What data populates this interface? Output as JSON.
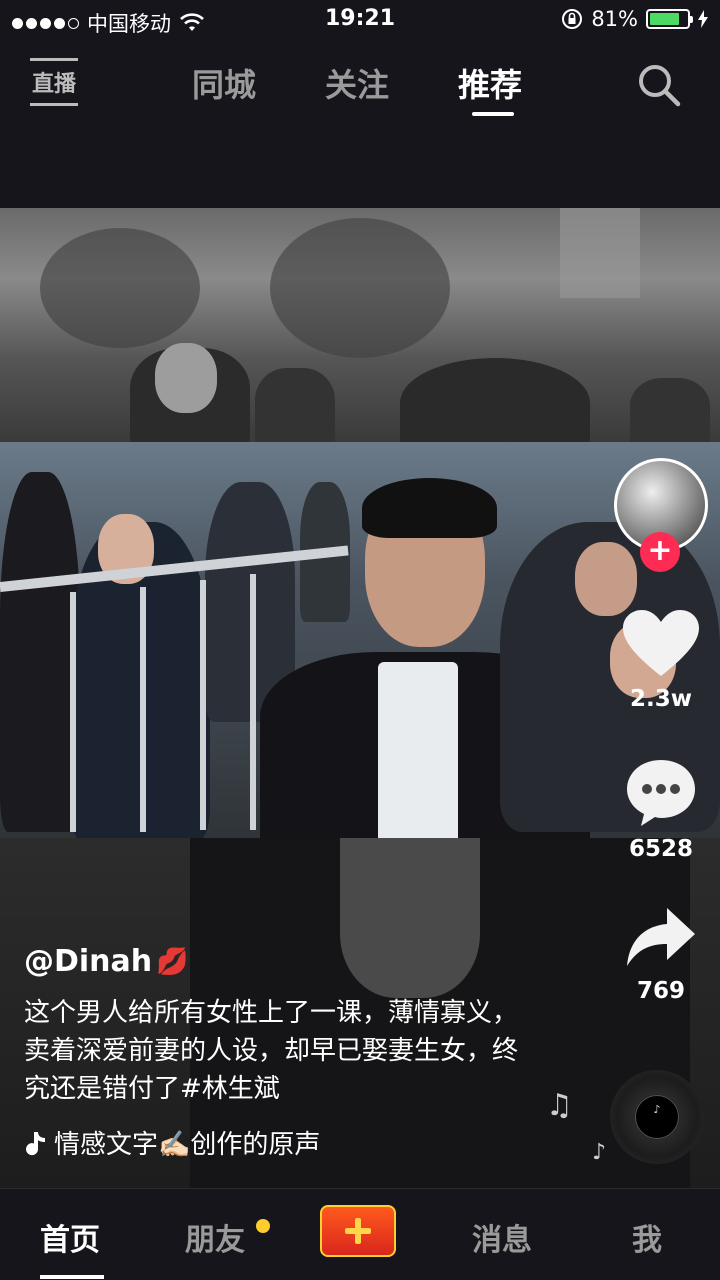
{
  "status_bar": {
    "carrier": "中国移动",
    "time": "19:21",
    "battery_percent": "81%",
    "battery_level": 0.81,
    "battery_color": "#4cd964"
  },
  "top_nav": {
    "live_label": "直播",
    "tabs": [
      {
        "label": "同城",
        "active": false
      },
      {
        "label": "关注",
        "active": false
      },
      {
        "label": "推荐",
        "active": true
      }
    ],
    "search_icon": "search-icon"
  },
  "actions": {
    "likes": "2.3w",
    "comments": "6528",
    "shares": "769"
  },
  "post": {
    "author": "@Dinah",
    "author_emoji": "💋",
    "caption": "这个男人给所有女性上了一课，薄情寡义，卖着深爱前妻的人设，却早已娶妻生女，终究还是错付了#林生斌",
    "music": "情感文字✍🏻创作的原声"
  },
  "tab_bar": {
    "items": [
      {
        "label": "首页",
        "active": true
      },
      {
        "label": "朋友",
        "active": false
      },
      {
        "label": "消息",
        "active": false
      },
      {
        "label": "我",
        "active": false
      }
    ],
    "create_label": "+",
    "accent": "#fe2c55",
    "badge_color": "#fecc2e"
  }
}
